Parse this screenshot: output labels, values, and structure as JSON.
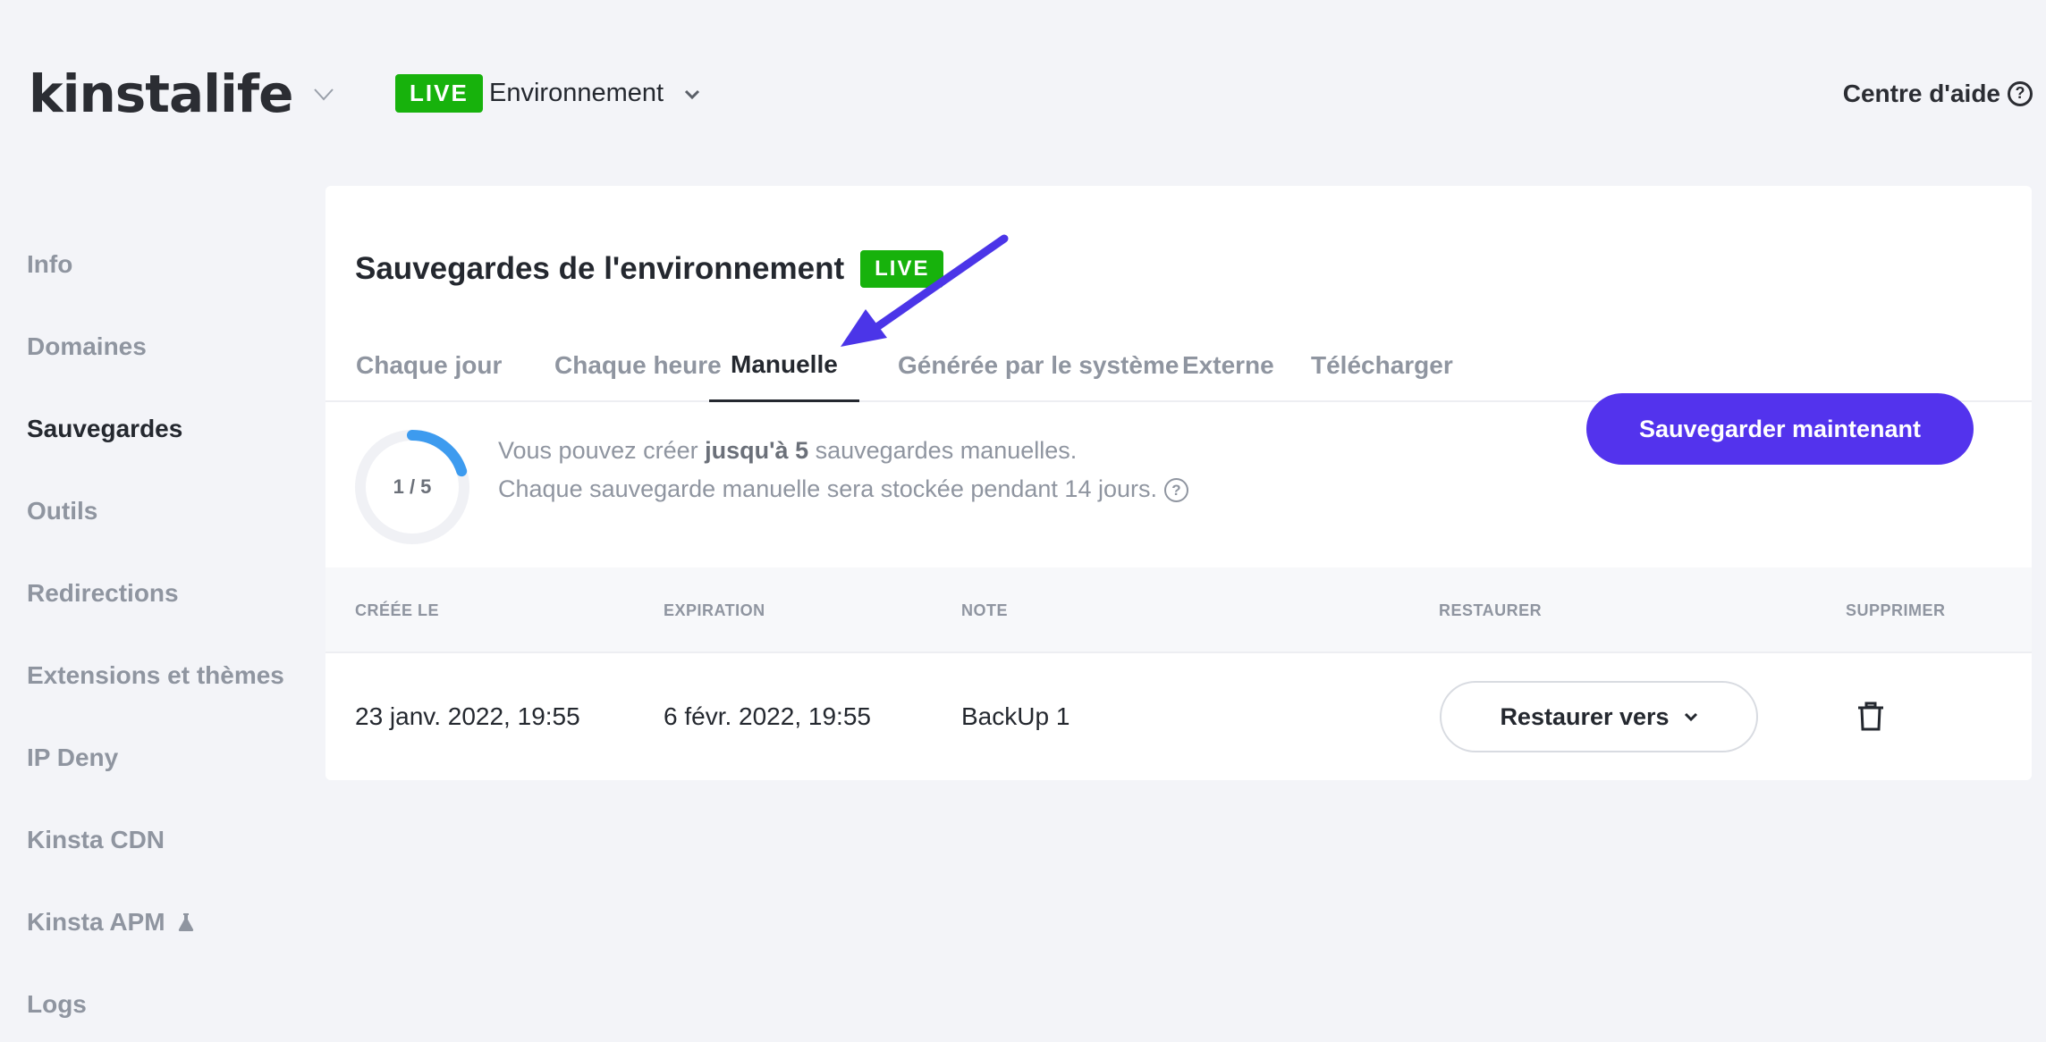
{
  "header": {
    "brand": "kinstalife",
    "env_badge": "LIVE",
    "env_label": "Environnement",
    "help_label": "Centre d'aide"
  },
  "sidebar": {
    "items": [
      {
        "label": "Info"
      },
      {
        "label": "Domaines"
      },
      {
        "label": "Sauvegardes",
        "active": true
      },
      {
        "label": "Outils"
      },
      {
        "label": "Redirections"
      },
      {
        "label": "Extensions et thèmes"
      },
      {
        "label": "IP Deny"
      },
      {
        "label": "Kinsta CDN"
      },
      {
        "label": "Kinsta APM",
        "icon": "flask-icon"
      },
      {
        "label": "Logs"
      }
    ]
  },
  "card": {
    "title": "Sauvegardes de l'environnement",
    "title_badge": "LIVE",
    "tabs": [
      {
        "label": "Chaque jour"
      },
      {
        "label": "Chaque heure"
      },
      {
        "label": "Manuelle",
        "active": true
      },
      {
        "label": "Générée par le système"
      },
      {
        "label": "Externe"
      },
      {
        "label": "Télécharger"
      }
    ],
    "summary": {
      "counter": "1 / 5",
      "used": 1,
      "limit": 5,
      "line1_prefix": "Vous pouvez créer ",
      "line1_bold": "jusqu'à 5",
      "line1_suffix": " sauvegardes manuelles.",
      "line2": "Chaque sauvegarde manuelle sera stockée pendant 14 jours.",
      "info_icon": "?"
    },
    "primary_button": "Sauvegarder maintenant",
    "table": {
      "headers": [
        "CRÉÉE LE",
        "EXPIRATION",
        "NOTE",
        "RESTAURER",
        "SUPPRIMER"
      ],
      "rows": [
        {
          "created": "23 janv. 2022, 19:55",
          "expiration": "6 févr. 2022, 19:55",
          "note": "BackUp 1",
          "restore_label": "Restaurer vers"
        }
      ]
    }
  },
  "colors": {
    "accent": "#5333ed",
    "live_green": "#17b20c",
    "ring_progress": "#3d9bef",
    "arrow": "#4b35e8"
  }
}
